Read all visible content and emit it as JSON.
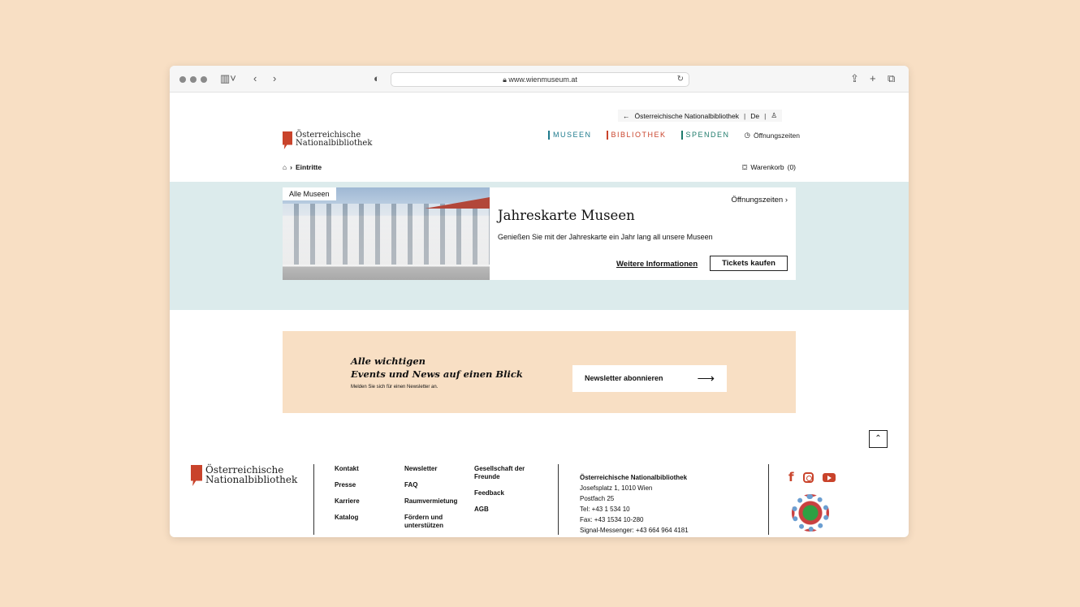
{
  "browser": {
    "url": "www.wienmuseum.at"
  },
  "topbar": {
    "back_link": "Österreichische Nationalbibliothek",
    "language": "De"
  },
  "logo": {
    "line1": "Österreichische",
    "line2": "Nationalbibliothek"
  },
  "nav": {
    "museen": "MUSEEN",
    "bibliothek": "BIBLIOTHEK",
    "spenden": "SPENDEN",
    "hours": "Öffnungszeiten"
  },
  "breadcrumb": {
    "current": "Eintritte"
  },
  "cart": {
    "label": "Warenkorb",
    "count": "(0)"
  },
  "hero": {
    "badge": "Alle Museen",
    "hours_link": "Öffnungszeiten",
    "title": "Jahreskarte Museen",
    "text": "Genießen Sie mit der Jahreskarte ein Jahr lang all unsere Museen",
    "more_link": "Weitere Informationen",
    "tickets_button": "Tickets kaufen"
  },
  "newsletter": {
    "title_line1": "Alle wichtigen",
    "title_line2": "Events und News auf einen Blick",
    "subtitle": "Melden Sie sich für einen Newsletter an.",
    "button": "Newsletter abonnieren"
  },
  "footer": {
    "col1": [
      "Kontakt",
      "Presse",
      "Karriere",
      "Katalog"
    ],
    "col2": [
      "Newsletter",
      "FAQ",
      "Raumvermietung",
      "Fördern und unterstützen"
    ],
    "col3": [
      "Gesellschaft der Freunde",
      "Feedback",
      "AGB"
    ],
    "address": {
      "name": "Österreichische Nationalbibliothek",
      "street": "Josefsplatz 1, 1010 Wien",
      "postfach": "Postfach 25",
      "tel": "Tel: +43 1 534 10",
      "fax": "Fax: +43 1534 10-280",
      "signal": "Signal-Messenger: +43 664 964 4181"
    }
  },
  "colors": {
    "accent": "#c9432b",
    "museen": "#1d7a8c",
    "spenden": "#1d7a6a",
    "hero_band": "#dcebec",
    "newsletter_bg": "#f8dfc4"
  }
}
